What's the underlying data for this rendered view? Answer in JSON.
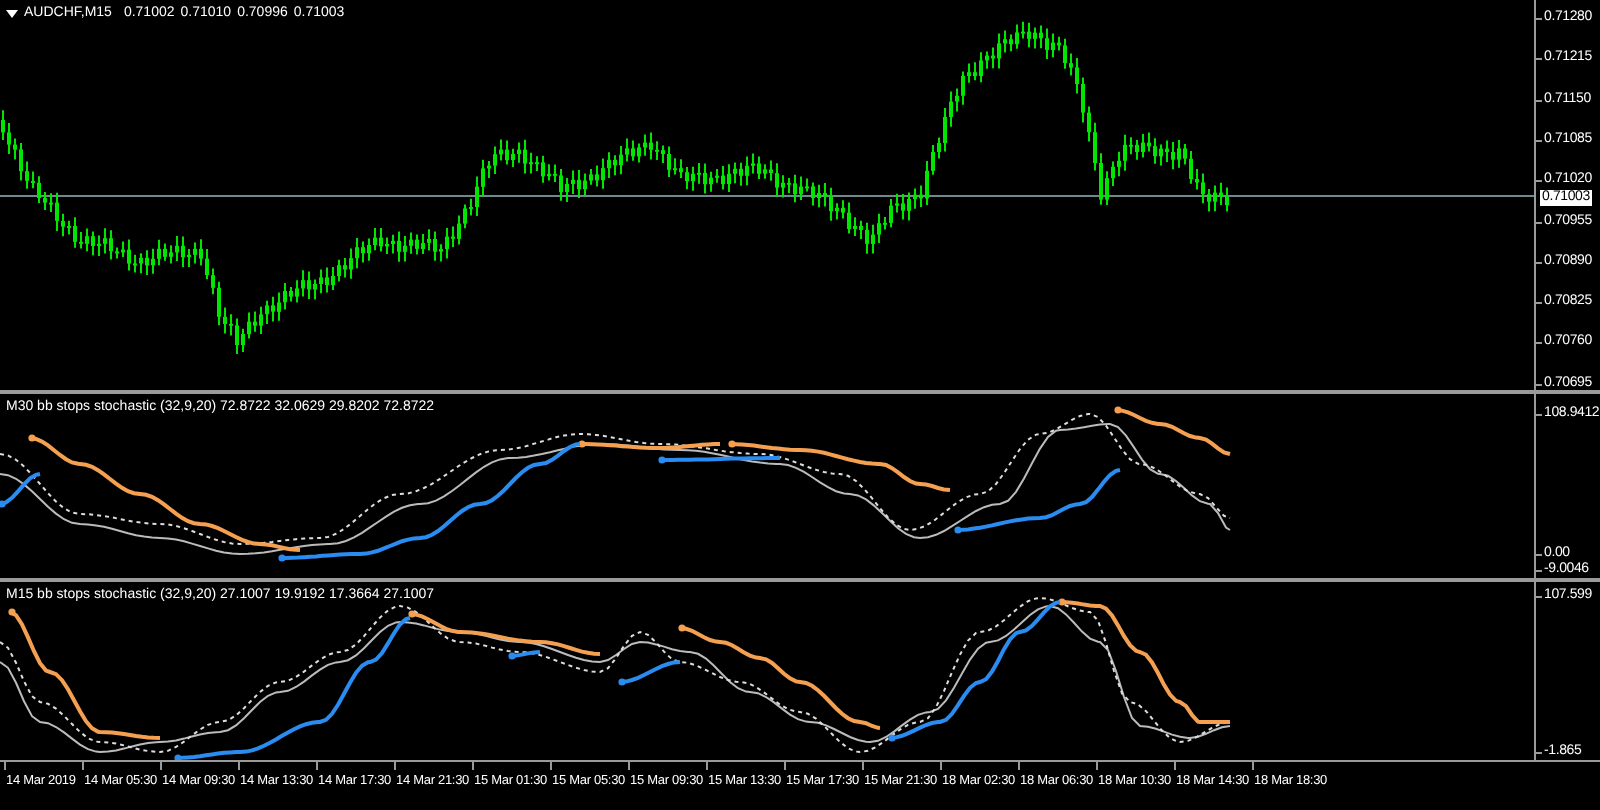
{
  "chart": {
    "symbol": "AUDCHF,M15",
    "ohlc": [
      "0.71002",
      "0.71010",
      "0.70996",
      "0.71003"
    ],
    "price_axis": [
      "0.71280",
      "0.71215",
      "0.71150",
      "0.71085",
      "0.71020",
      "0.70955",
      "0.70890",
      "0.70825",
      "0.70760",
      "0.70695"
    ],
    "current_price": "0.71003"
  },
  "indicators": [
    {
      "title": "M30 bb stops stochastic (32,9,20) 72.8722 32.0629 29.8202 72.8722",
      "axis": [
        "108.9412",
        "0.00",
        "-9.0046"
      ]
    },
    {
      "title": "M15 bb stops stochastic (32,9,20) 27.1007 19.9192 17.3664 27.1007",
      "axis": [
        "107.599",
        "-1.865"
      ]
    }
  ],
  "time_axis": [
    "14 Mar 2019",
    "14 Mar 05:30",
    "14 Mar 09:30",
    "14 Mar 13:30",
    "14 Mar 17:30",
    "14 Mar 21:30",
    "15 Mar 01:30",
    "15 Mar 05:30",
    "15 Mar 09:30",
    "15 Mar 13:30",
    "15 Mar 17:30",
    "15 Mar 21:30",
    "18 Mar 02:30",
    "18 Mar 06:30",
    "18 Mar 10:30",
    "18 Mar 14:30",
    "18 Mar 18:30"
  ]
}
